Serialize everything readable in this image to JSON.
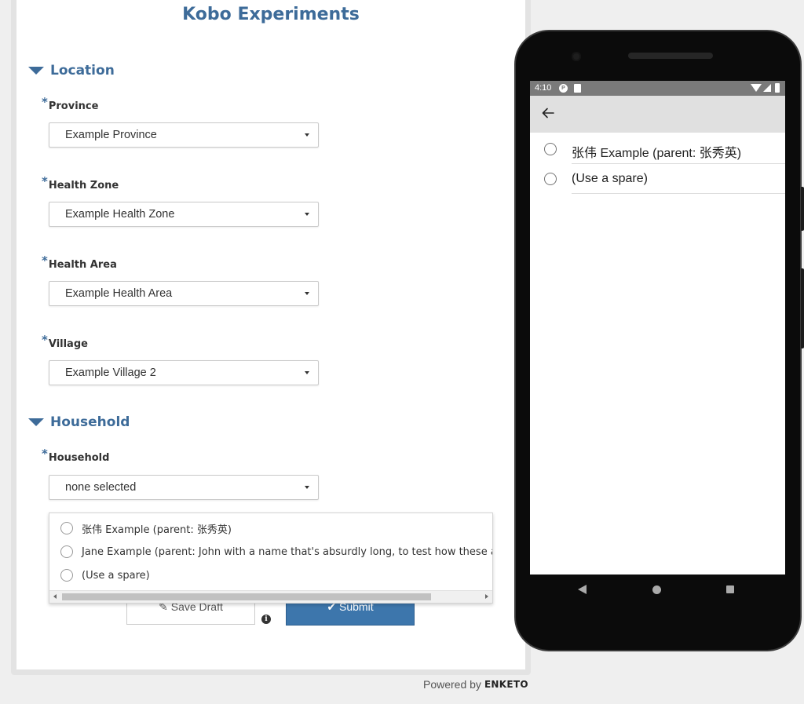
{
  "form": {
    "title": "Kobo Experiments",
    "groups": [
      {
        "title": "Location"
      },
      {
        "title": "Household"
      }
    ],
    "required_mark": "*",
    "questions": [
      {
        "label": "Province",
        "value": "Example Province"
      },
      {
        "label": "Health Zone",
        "value": "Example Health Zone"
      },
      {
        "label": "Health Area",
        "value": "Example Health Area"
      },
      {
        "label": "Village",
        "value": "Example Village 2"
      },
      {
        "label": "Household",
        "value": "none selected"
      }
    ],
    "dropdown_options": [
      "张伟 Example (parent: 张秀英)",
      "Jane Example (parent: John with a name that's absurdly long, to test how these are",
      "(Use a spare)"
    ],
    "buttons": {
      "save_draft": "Save Draft",
      "submit": "Submit"
    },
    "powered_by": "Powered by",
    "brand": "ENKETO",
    "info_glyph": "i"
  },
  "phone": {
    "status_time": "4:10",
    "status_icon_glyph": "P",
    "options": [
      "张伟 Example (parent: 张秀英)",
      "(Use a spare)"
    ]
  },
  "colors": {
    "accent": "#3d6b99",
    "submit_bg": "#3d76ac",
    "status_bar": "#7a7a7a",
    "app_bar": "#e0e0e0"
  }
}
